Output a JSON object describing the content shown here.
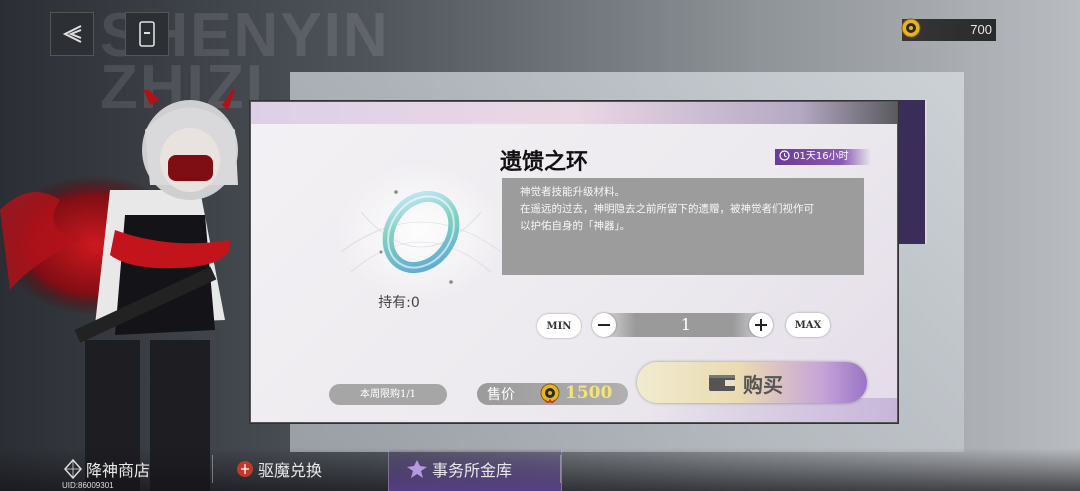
{
  "background": {
    "watermark_lines": [
      "SHENYIN",
      "ZHIZI"
    ]
  },
  "topbar": {
    "back_icon": "back-arrow-icon",
    "phone_icon": "phone-icon"
  },
  "currency": {
    "icon": "coin-icon",
    "value": "700"
  },
  "dialog": {
    "item_name": "遗馈之环",
    "timer": "01天16小时",
    "description": [
      "神觉者技能升级材料。",
      "在遥远的过去，神明隐去之前所留下的遗赠，被神觉者们视作可",
      "以护佑自身的「神器」。"
    ],
    "owned": "持有:0",
    "quantity": {
      "min_label": "MIN",
      "max_label": "MAX",
      "value": "1"
    },
    "weekly_limit": "本周限购1/1",
    "price": {
      "label": "售价",
      "value": "1500",
      "icon": "coin-icon"
    },
    "buy_label": "购买",
    "colors": {
      "timer_purple": "#7a4aa8",
      "price_gold": "#f5e37a"
    }
  },
  "bottom_nav": {
    "items": [
      {
        "label": "降神商店"
      },
      {
        "label": "驱魔兑换"
      },
      {
        "label": "事务所金库"
      }
    ],
    "active_index": 2,
    "uid": "UID:86009301"
  }
}
